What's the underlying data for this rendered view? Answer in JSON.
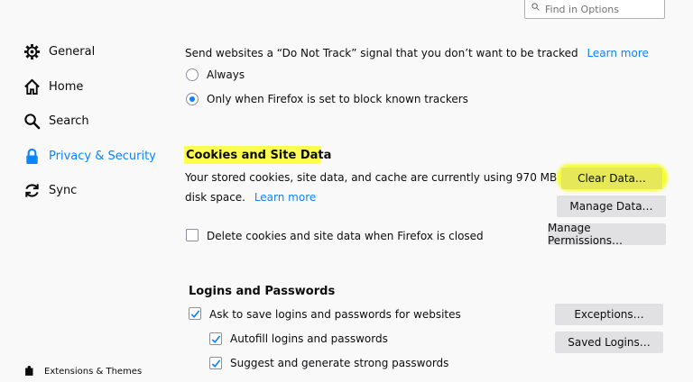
{
  "search": {
    "placeholder": "Find in Options"
  },
  "sidebar": {
    "items": [
      {
        "label": "General",
        "icon": "gear-icon"
      },
      {
        "label": "Home",
        "icon": "home-icon"
      },
      {
        "label": "Search",
        "icon": "search-icon"
      },
      {
        "label": "Privacy & Security",
        "icon": "lock-icon",
        "selected": true
      },
      {
        "label": "Sync",
        "icon": "sync-icon"
      }
    ],
    "extensions_label": "Extensions & Themes"
  },
  "dnt": {
    "text": "Send websites a “Do Not Track” signal that you don’t want to be tracked",
    "learn_more": "Learn more",
    "options": [
      "Always",
      "Only when Firefox is set to block known trackers"
    ],
    "selected_index": 1
  },
  "cookies": {
    "title": "Cookies and Site Data",
    "desc_line1": "Your stored cookies, site data, and cache are currently using 970 MB of",
    "desc_line2": "disk space.",
    "learn_more": "Learn more",
    "delete_checkbox": "Delete cookies and site data when Firefox is closed",
    "delete_checked": false,
    "buttons": {
      "clear": "Clear Data…",
      "manage": "Manage Data…",
      "permissions": "Manage Permissions…"
    }
  },
  "logins": {
    "title": "Logins and Passwords",
    "ask_label": "Ask to save logins and passwords for websites",
    "autofill_label": "Autofill logins and passwords",
    "suggest_label": "Suggest and generate strong passwords",
    "checked": [
      true,
      true,
      true
    ],
    "buttons": {
      "exceptions": "Exceptions…",
      "saved": "Saved Logins…"
    }
  },
  "colors": {
    "accent": "#0a84ff",
    "highlight": "#ffff33",
    "button": "#e1e1e3"
  }
}
